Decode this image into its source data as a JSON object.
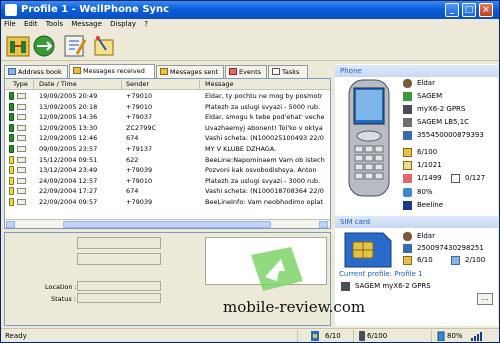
{
  "window": {
    "title": "Profile 1 - WellPhone Sync"
  },
  "menu": [
    "File",
    "Edit",
    "Tools",
    "Message",
    "Display",
    "?"
  ],
  "toolbar": {
    "buttons": [
      "sync-icon",
      "connect-icon",
      "edit-icon",
      "wizard-icon"
    ]
  },
  "tabs": [
    {
      "label": "Address book",
      "icon": "address-book-icon",
      "active": false
    },
    {
      "label": "Messages received",
      "icon": "message-icon",
      "active": true
    },
    {
      "label": "Messages sent",
      "icon": "message-sent-icon",
      "active": false
    },
    {
      "label": "Events",
      "icon": "events-icon",
      "active": false
    },
    {
      "label": "Tasks",
      "icon": "tasks-icon",
      "active": false
    }
  ],
  "grid": {
    "columns": [
      "Type",
      "Date / Time",
      "Sender",
      "Message"
    ],
    "rows": [
      {
        "type": "phone",
        "date": "19/09/2005 20:49",
        "sender": "+79010",
        "message": "Eldar, ty pochtu ne mog by posmotr"
      },
      {
        "type": "phone",
        "date": "13/09/2005 20:18",
        "sender": "+79010",
        "message": "Platezh za uslugi svyazi - 5000 rub."
      },
      {
        "type": "phone",
        "date": "12/09/2005 14:36",
        "sender": "+79037",
        "message": "Eldar, smogu k tebe pod'ehat' veche"
      },
      {
        "type": "phone",
        "date": "12/09/2005 13:30",
        "sender": "ZC2799C",
        "message": "Uvazhaemyj abonent! Tol'ko v oktya"
      },
      {
        "type": "phone",
        "date": "12/09/2005 12:46",
        "sender": "674",
        "message": "Vashi scheta: (N100025100493 22/0"
      },
      {
        "type": "phone",
        "date": "09/09/2005 23:57",
        "sender": "+79137",
        "message": "MY V KLUBE DZHAGA."
      },
      {
        "type": "sim",
        "date": "15/12/2004 09:51",
        "sender": "622",
        "message": "BeeLine:Napominaem Vam ob istech"
      },
      {
        "type": "sim",
        "date": "13/12/2004 23:49",
        "sender": "+79039",
        "message": "Pozvoni kak osvobodishsya. Anton"
      },
      {
        "type": "sim",
        "date": "24/09/2004 12:57",
        "sender": "+79010",
        "message": "Platezh za uslugi svyazi - 3000 rub."
      },
      {
        "type": "sim",
        "date": "22/09/2004 17:27",
        "sender": "674",
        "message": "Vashi scheta: (N100018708364 22/0"
      },
      {
        "type": "sim",
        "date": "22/09/2004 09:57",
        "sender": "+79039",
        "message": "BeeLineInfo: Vam neobhodimo oplat"
      }
    ]
  },
  "detail": {
    "location_label": "Location :",
    "status_label": "Status :"
  },
  "phone_panel": {
    "title": "Phone",
    "owner": "Eldar",
    "brand": "SAGEM",
    "model": "myX6-2 GPRS",
    "firmware": "SAGEM LB5,1C",
    "imei": "355450000879393",
    "memory": "6/100",
    "messages": "1/1021",
    "calendar": "1/1499",
    "tasks": "0/127",
    "battery": "80%",
    "operator": "Beeline"
  },
  "sim_panel": {
    "title": "SIM card",
    "owner": "Eldar",
    "number": "250097430298251",
    "sms": "6/10",
    "contacts": "2/100"
  },
  "profile": {
    "label": "Current profile: Profile 1",
    "device": "SAGEM myX6-2 GPRS",
    "button": "..."
  },
  "statusbar": {
    "status": "Ready",
    "sim": "6/10",
    "phone": "6/100",
    "battery": "80%"
  },
  "watermark": "mobile-review.com",
  "colors": {
    "title_bar": "#0b5ed7",
    "section_header": "#c6d8f4",
    "section_text": "#215dc6"
  }
}
